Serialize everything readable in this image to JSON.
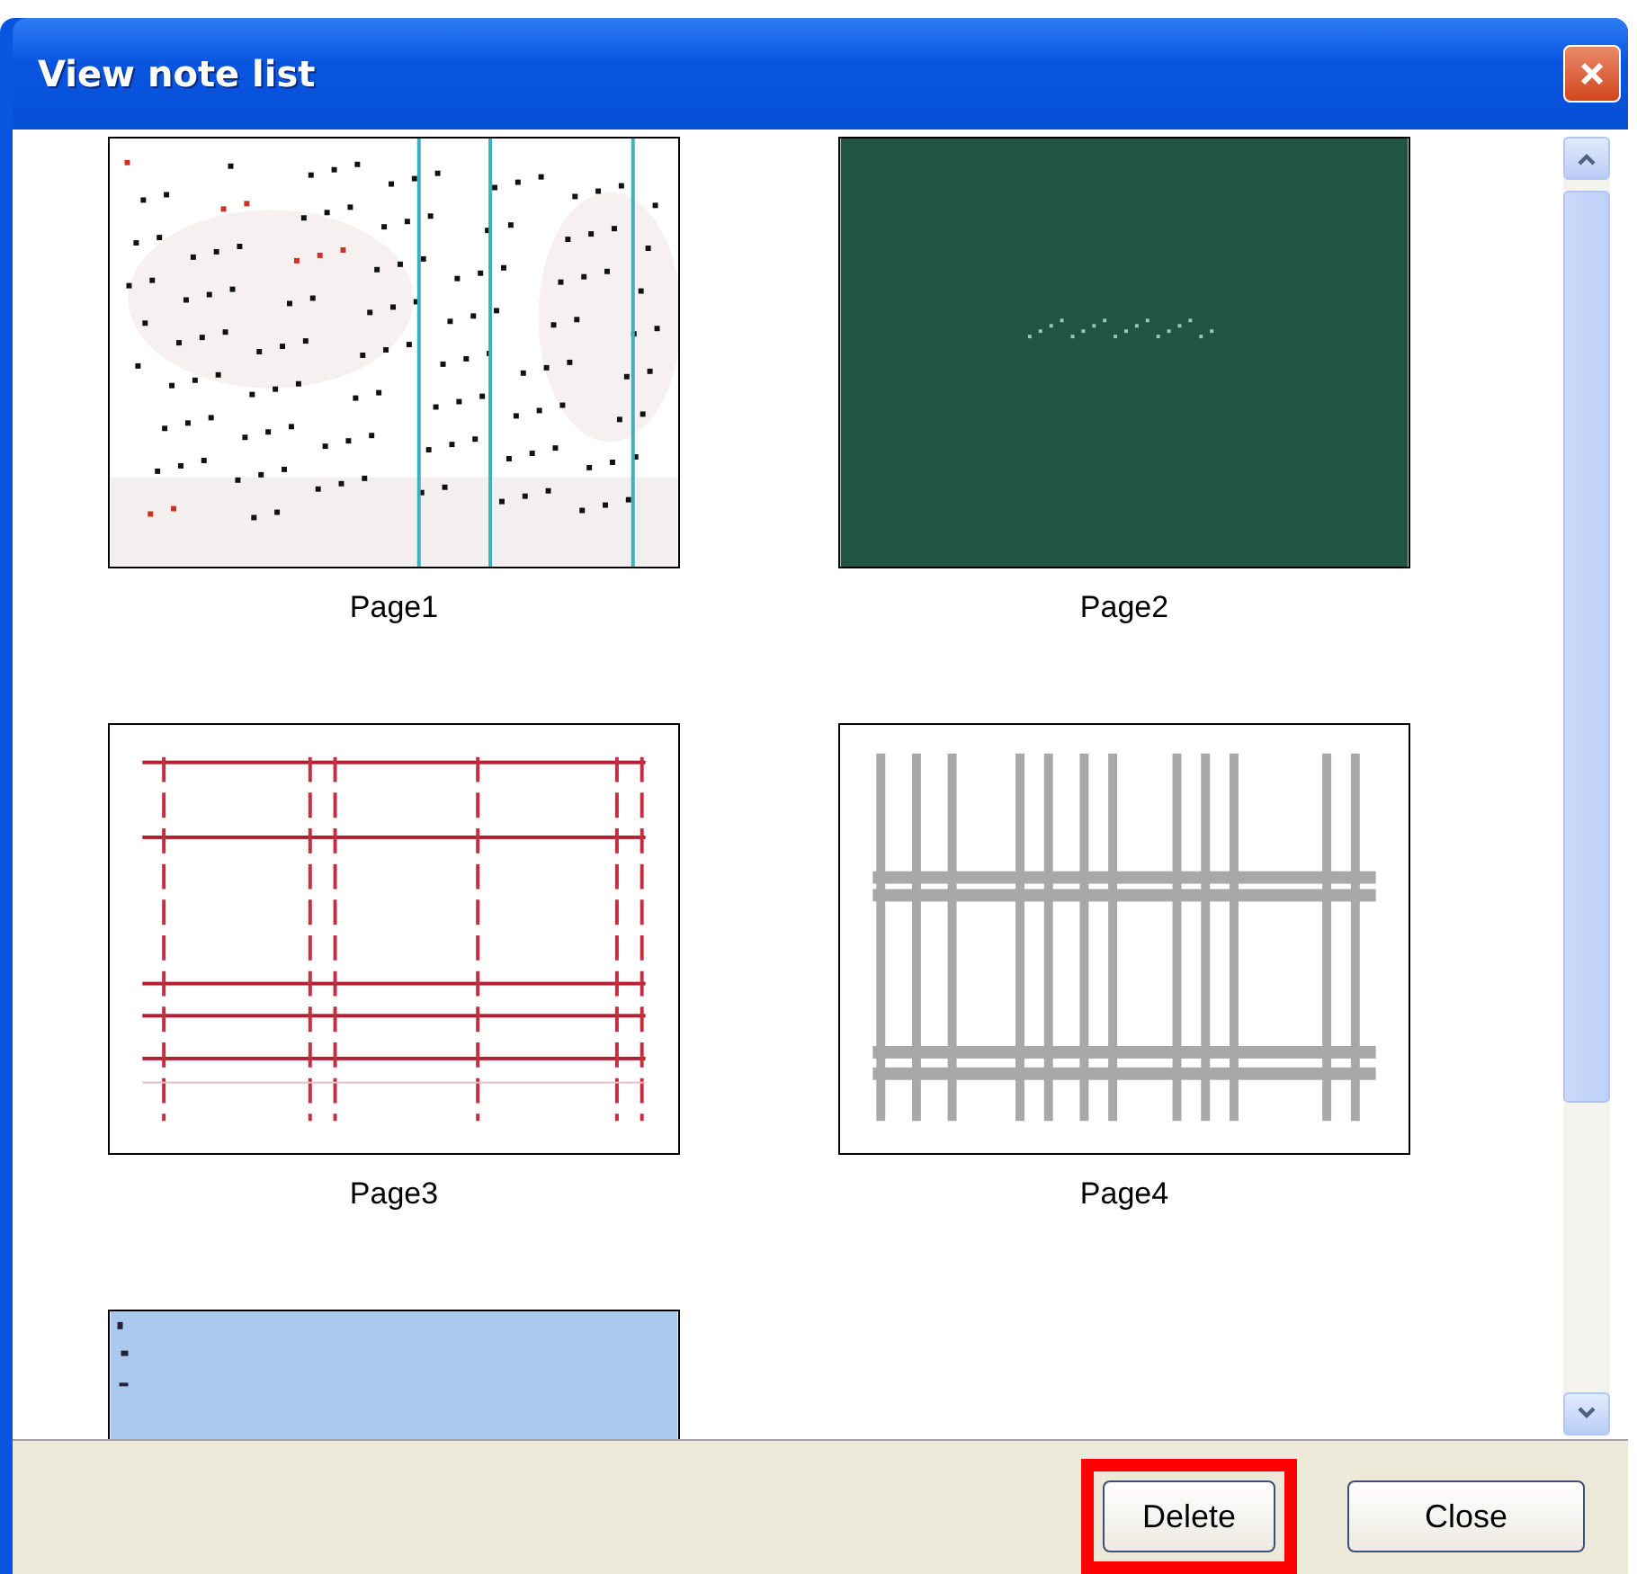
{
  "window": {
    "title": "View note list"
  },
  "pages": [
    {
      "label": "Page1",
      "kind": "map"
    },
    {
      "label": "Page2",
      "kind": "board"
    },
    {
      "label": "Page3",
      "kind": "red-grid"
    },
    {
      "label": "Page4",
      "kind": "grey-grid"
    },
    {
      "kind": "blue"
    }
  ],
  "buttons": [
    {
      "label": "Delete",
      "highlighted": true
    },
    {
      "label": "Close",
      "highlighted": false
    }
  ]
}
